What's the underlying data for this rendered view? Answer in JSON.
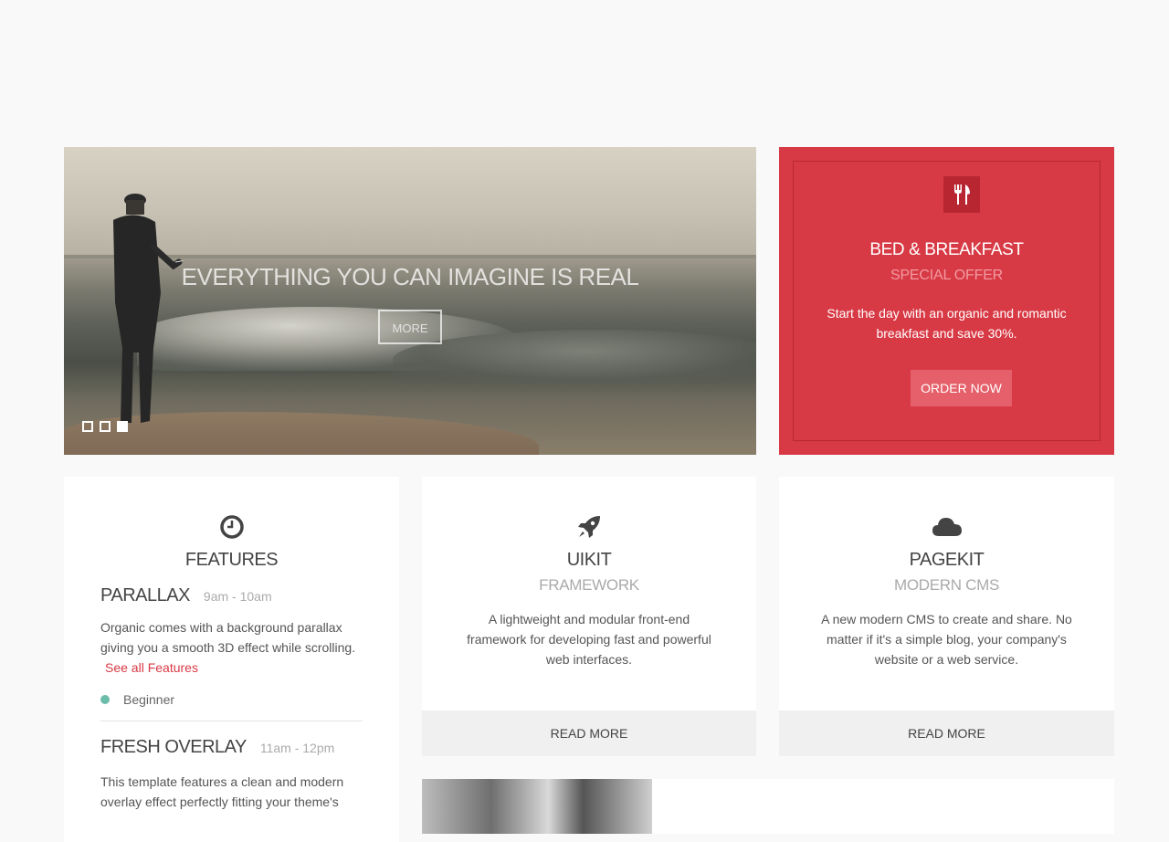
{
  "slideshow": {
    "title": "EVERYTHING YOU CAN IMAGINE IS REAL",
    "button": "MORE",
    "dots": 3,
    "active_dot": 3
  },
  "offer": {
    "icon": "cutlery-icon",
    "title": "BED & BREAKFAST",
    "subtitle": "SPECIAL OFFER",
    "text": "Start the day with an organic and romantic breakfast and save 30%.",
    "button": "ORDER NOW",
    "color": "#d83a45"
  },
  "features": {
    "icon": "clock-icon",
    "title": "FEATURES",
    "items": [
      {
        "name": "PARALLAX",
        "time": "9am - 10am",
        "desc": "Organic comes with a background parallax giving you a smooth 3D effect while scrolling.",
        "link": "See all Features",
        "level": "Beginner"
      },
      {
        "name": "FRESH OVERLAY",
        "time": "11am - 12pm",
        "desc": "This template features a clean and modern overlay effect perfectly fitting your theme's"
      }
    ]
  },
  "uikit": {
    "icon": "rocket-icon",
    "title": "UIKIT",
    "subtitle": "FRAMEWORK",
    "text": "A lightweight and modular front-end framework for developing fast and powerful web interfaces.",
    "button": "READ MORE"
  },
  "pagekit": {
    "icon": "cloud-icon",
    "title": "PAGEKIT",
    "subtitle": "MODERN CMS",
    "text": "A new modern CMS to create and share. No matter if it's a simple blog, your company's website or a web service.",
    "button": "READ MORE"
  },
  "colors": {
    "accent": "#d83a45",
    "level_dot": "#6cbcaa"
  }
}
